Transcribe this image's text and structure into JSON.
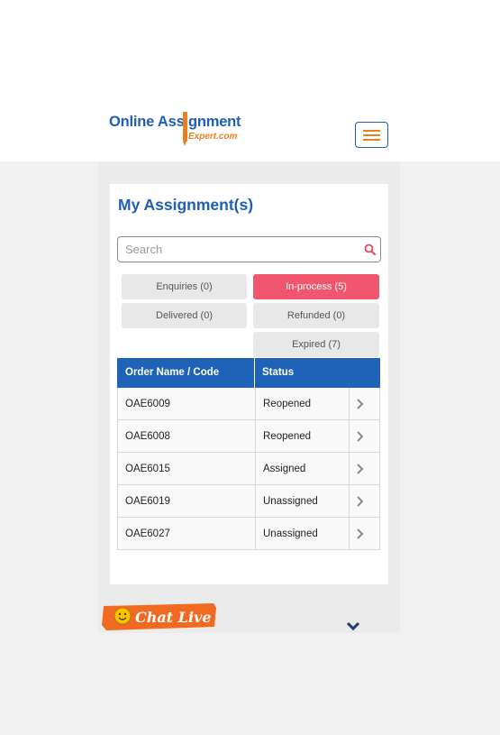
{
  "header": {
    "logo_line1": "Online Assignment",
    "logo_line2": "Expert.com"
  },
  "title": "My Assignment(s)",
  "search": {
    "placeholder": "Search",
    "value": ""
  },
  "tabs": [
    {
      "label": "Enquiries (0)",
      "active": false
    },
    {
      "label": "In-process (5)",
      "active": true
    },
    {
      "label": "Delivered (0)",
      "active": false
    },
    {
      "label": "Refunded (0)",
      "active": false
    },
    {
      "label": "Expired (7)",
      "active": false
    }
  ],
  "table": {
    "headers": [
      "Order Name / Code",
      "Status"
    ],
    "rows": [
      {
        "code": "OAE6009",
        "status": "Reopened"
      },
      {
        "code": "OAE6008",
        "status": "Reopened"
      },
      {
        "code": "OAE6015",
        "status": "Assigned"
      },
      {
        "code": "OAE6019",
        "status": "Unassigned"
      },
      {
        "code": "OAE6027",
        "status": "Unassigned"
      }
    ]
  },
  "chat": {
    "label": "Chat Live"
  },
  "colors": {
    "brand_blue": "#1f5fb4",
    "brand_orange": "#e8801f",
    "active_tab": "#f0566d",
    "table_header": "#1e63b8",
    "chat_orange": "#f06a22"
  }
}
